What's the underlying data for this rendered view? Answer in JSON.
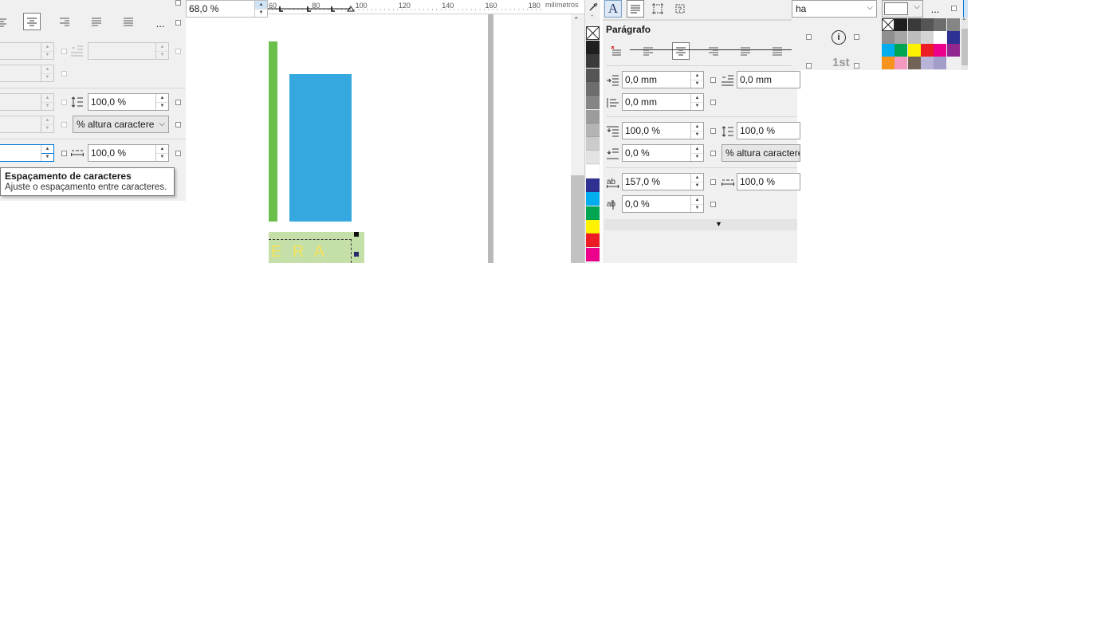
{
  "left_panel": {
    "more_label": "...",
    "line_spacing_value": "100,0 %",
    "unit_value": "% altura caractere",
    "char_scale_value": "100,0 %"
  },
  "tooltip": {
    "title": "Espaçamento de caracteres",
    "body": "Ajuste o espaçamento entre caracteres."
  },
  "canvas": {
    "zoom_value": "68,0 %",
    "ruler_labels": [
      "60",
      "80",
      "100",
      "120",
      "140",
      "160",
      "180"
    ],
    "ruler_unit": "milímetros",
    "text_frame_content": "E R A"
  },
  "palette": {
    "colors": [
      "#1f1f1f",
      "#3a3a3a",
      "#555555",
      "#6d6d6d",
      "#858585",
      "#9c9c9c",
      "#b4b4b4",
      "#cbcbcb",
      "#e3e3e3",
      "#ffffff",
      "#2e3192",
      "#00aeef",
      "#00a651",
      "#fff200",
      "#ed1c24",
      "#ec008c"
    ]
  },
  "paragraph_panel": {
    "title": "Parágrafo",
    "indent_left": "0,0 mm",
    "indent_right": "0,0 mm",
    "indent_first": "0,0 mm",
    "line_spacing_before": "100,0 %",
    "line_spacing": "100,0 %",
    "para_spacing_after": "0,0 %",
    "unit_label": "% altura caractere",
    "char_spacing": "157,0 %",
    "word_spacing": "100,0 %",
    "language_spacing": "0,0 %"
  },
  "right_toolbar": {
    "font_value": "ha",
    "more_label": "...",
    "superscript_label": "1st",
    "info_label": "i"
  },
  "mini_palette": {
    "colors": [
      "#1f1f1f",
      "#3a3a3a",
      "#555555",
      "#6d6d6d",
      "#858585",
      "#8f8f8f",
      "#a6a6a6",
      "#bdbdbd",
      "#d4d4d4",
      "#ffffff",
      "#2e3192",
      "#00aeef",
      "#00a651",
      "#fff200",
      "#ed1c24",
      "#ec008c",
      "#92278f",
      "#f7941d",
      "#f49ac1",
      "#736357",
      "#b9b3d7",
      "#a29dc9"
    ]
  },
  "colors": {
    "accent": "#0078d7",
    "green_bar": "#6abf4b",
    "blue_rect": "#35a8df",
    "text_frame_bg": "#c5dfa8",
    "frame_text": "#f5e35a"
  }
}
